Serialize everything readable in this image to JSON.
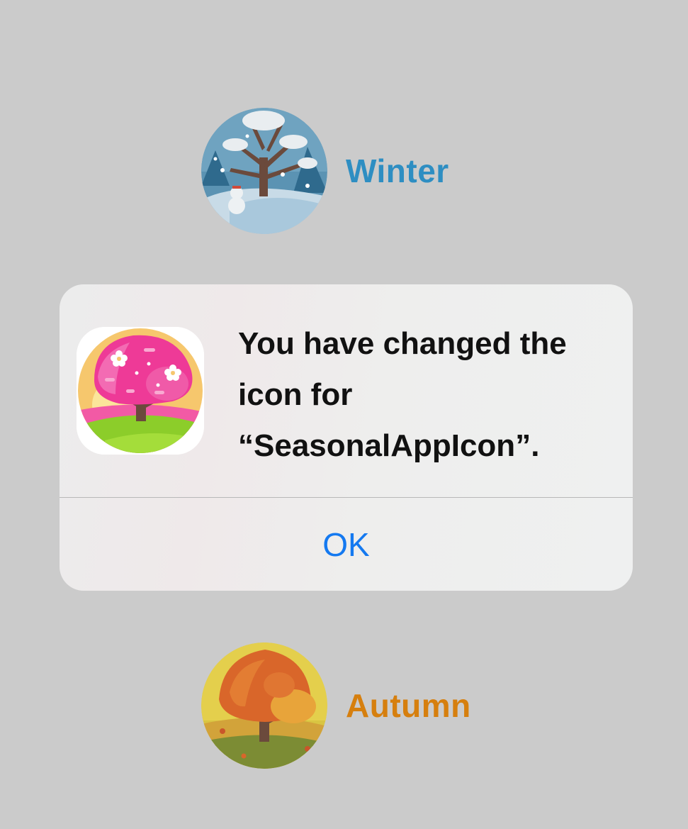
{
  "seasons": {
    "winter": {
      "label": "Winter",
      "icon": "winter-tree-icon",
      "color": "#2e8ec2"
    },
    "autumn": {
      "label": "Autumn",
      "icon": "autumn-tree-icon",
      "color": "#d67f0e"
    }
  },
  "alert": {
    "app_icon": "spring-blossom-tree-icon",
    "message_lines": [
      "You have changed the",
      "icon for",
      "“SeasonalAppIcon”."
    ],
    "ok_label": "OK",
    "ok_color": "#1479f0"
  }
}
